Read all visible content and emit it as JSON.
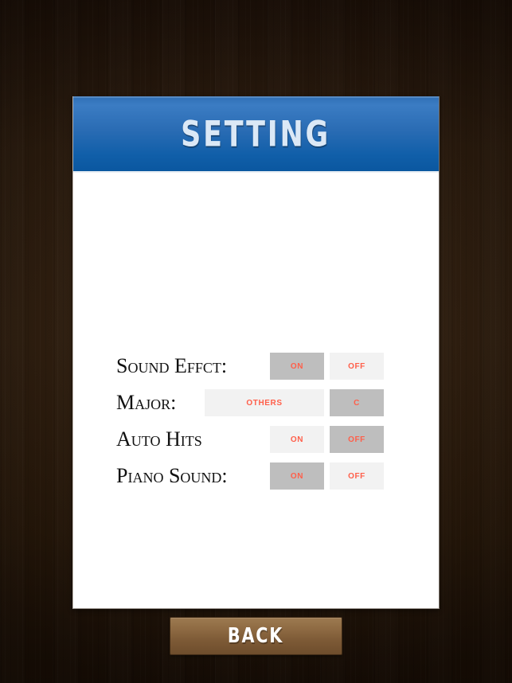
{
  "header": {
    "title": "SETTING",
    "gradient_top": "#3b7cc3",
    "gradient_bottom": "#0a57a0"
  },
  "theme": {
    "accent_text": "#ff5f4a",
    "option_selected_bg": "#bebebe",
    "option_bg": "#f2f2f2",
    "background": "#2d1c0d",
    "card_bg": "#ffffff",
    "back_button_top": "#9d7a51",
    "back_button_bottom": "#6e4d2c"
  },
  "settings": {
    "rows": [
      {
        "label": "Sound Effct:",
        "options": [
          {
            "label": "ON",
            "selected": true,
            "wide": false
          },
          {
            "label": "OFF",
            "selected": false,
            "wide": false
          }
        ]
      },
      {
        "label": "Major:",
        "options": [
          {
            "label": "OTHERS",
            "selected": false,
            "wide": true
          },
          {
            "label": "C",
            "selected": true,
            "wide": false
          }
        ]
      },
      {
        "label": "Auto Hits",
        "options": [
          {
            "label": "ON",
            "selected": false,
            "wide": false
          },
          {
            "label": "OFF",
            "selected": true,
            "wide": false
          }
        ]
      },
      {
        "label": "Piano Sound:",
        "options": [
          {
            "label": "ON",
            "selected": true,
            "wide": false
          },
          {
            "label": "OFF",
            "selected": false,
            "wide": false
          }
        ]
      }
    ]
  },
  "footer": {
    "back_label": "BACK"
  }
}
